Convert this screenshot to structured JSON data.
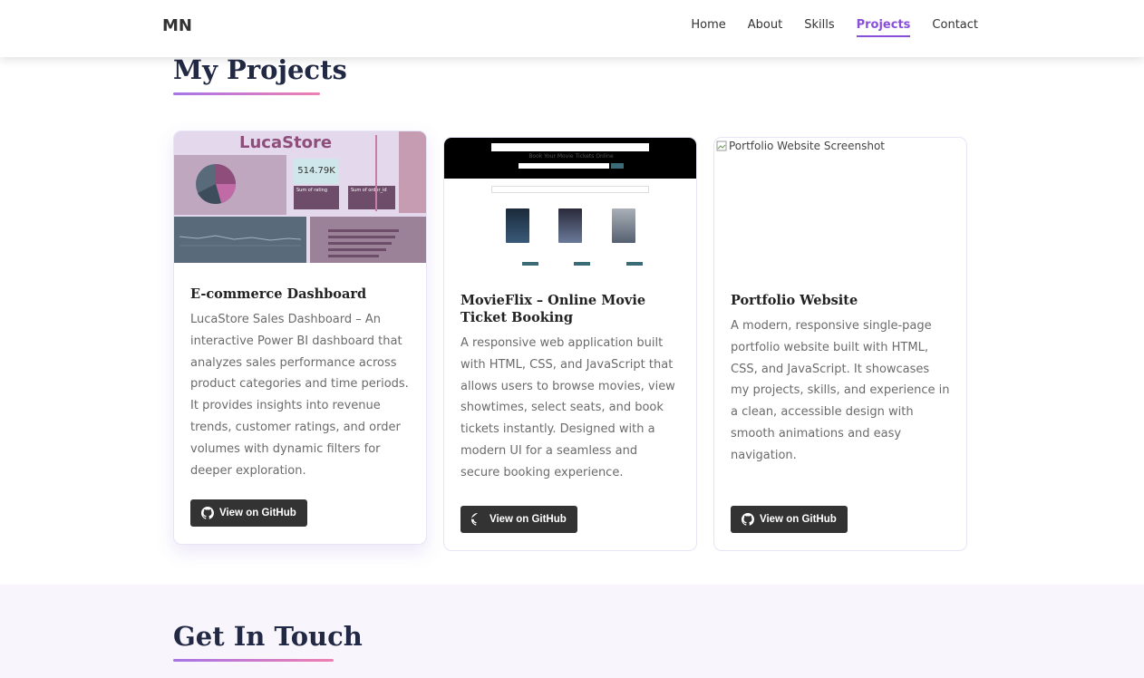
{
  "nav": {
    "logo": "MN",
    "links": [
      {
        "label": "Home"
      },
      {
        "label": "About"
      },
      {
        "label": "Skills"
      },
      {
        "label": "Projects"
      },
      {
        "label": "Contact"
      }
    ]
  },
  "projects": {
    "title": "My Projects",
    "cards": [
      {
        "title": "E-commerce Dashboard",
        "description": "LucaStore Sales Dashboard – An interactive Power BI dashboard that analyzes sales performance across product categories and time periods. It provides insights into revenue trends, customer ratings, and order volumes with dynamic filters for deeper exploration.",
        "button": "View on GitHub",
        "thumb": {
          "brand": "LucaStore",
          "kpi": "514.79K",
          "card_a": "Sum of rating",
          "card_b": "Sum of order_id"
        }
      },
      {
        "title": "MovieFlix – Online Movie Ticket Booking",
        "description": "A responsive web application built with HTML, CSS, and JavaScript that allows users to browse movies, view showtimes, select seats, and book tickets instantly. Designed with a modern UI for a seamless and secure booking experience.",
        "button": "View on GitHub",
        "thumb": {
          "heading": "Book Your Movie Tickets Online"
        }
      },
      {
        "title": "Portfolio Website",
        "description": "A modern, responsive single-page portfolio website built with HTML, CSS, and JavaScript. It showcases my projects, skills, and experience in a clean, accessible design with smooth animations and easy navigation.",
        "button": "View on GitHub",
        "image_alt": "Portfolio Website Screenshot"
      }
    ]
  },
  "contact": {
    "title": "Get In Touch"
  },
  "colors": {
    "accent": "#8a4fd8",
    "gradient_start": "#a775e6",
    "gradient_end": "#ef7fb2",
    "button_bg": "#333333",
    "heading": "#222944"
  }
}
